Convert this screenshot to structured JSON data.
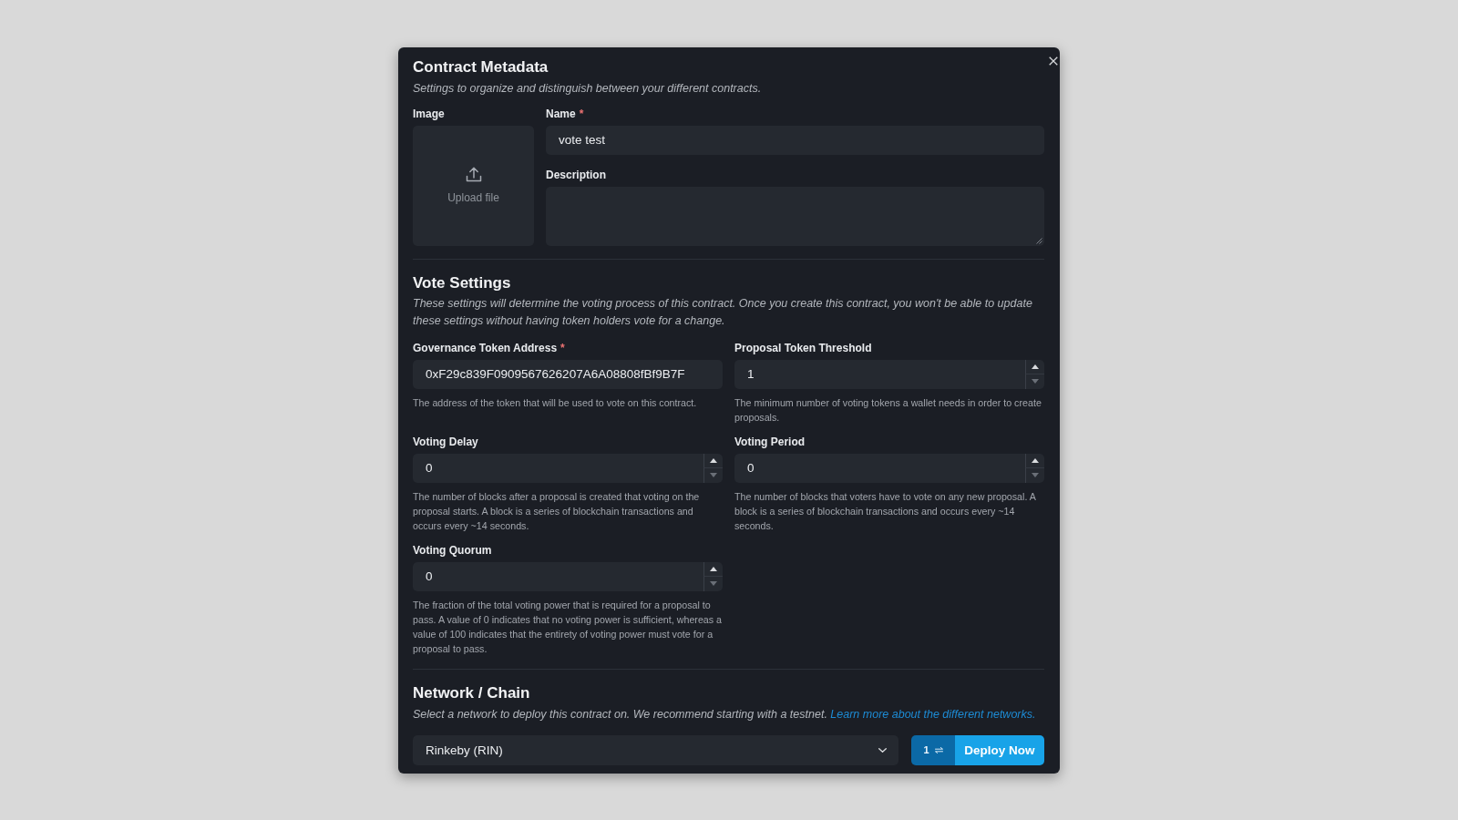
{
  "contract_metadata": {
    "title": "Contract Metadata",
    "description": "Settings to organize and distinguish between your different contracts.",
    "image": {
      "label": "Image",
      "upload_text": "Upload file"
    },
    "name": {
      "label": "Name",
      "required_mark": "*",
      "value": "vote test"
    },
    "description_field": {
      "label": "Description"
    }
  },
  "vote_settings": {
    "title": "Vote Settings",
    "description": "These settings will determine the voting process of this contract. Once you create this contract, you won't be able to update these settings without having token holders vote for a change.",
    "fields": [
      {
        "kind": "text",
        "label": "Governance Token Address",
        "required_mark": "*",
        "value": "0xF29c839F0909567626207A6A08808fBf9B7F",
        "help": "The address of the token that will be used to vote on this contract."
      },
      {
        "kind": "number",
        "label": "Proposal Token Threshold",
        "value": "1",
        "help": "The minimum number of voting tokens a wallet needs in order to create proposals."
      },
      {
        "kind": "number",
        "label": "Voting Delay",
        "value": "0",
        "help": "The number of blocks after a proposal is created that voting on the proposal starts. A block is a series of blockchain transactions and occurs every ~14 seconds."
      },
      {
        "kind": "number",
        "label": "Voting Period",
        "value": "0",
        "help": "The number of blocks that voters have to vote on any new proposal. A block is a series of blockchain transactions and occurs every ~14 seconds."
      },
      {
        "kind": "number",
        "label": "Voting Quorum",
        "value": "0",
        "help": "The fraction of the total voting power that is required for a proposal to pass. A value of 0 indicates that no voting power is sufficient, whereas a value of 100 indicates that the entirety of voting power must vote for a proposal to pass."
      }
    ]
  },
  "network_chain": {
    "title": "Network / Chain",
    "description": "Select a network to deploy this contract on. We recommend starting with a testnet.",
    "link": "Learn more about the different networks.",
    "network_select": {
      "value": "Rinkeby (RIN)"
    },
    "transaction_count": "1",
    "deploy_button": "Deploy Now"
  }
}
